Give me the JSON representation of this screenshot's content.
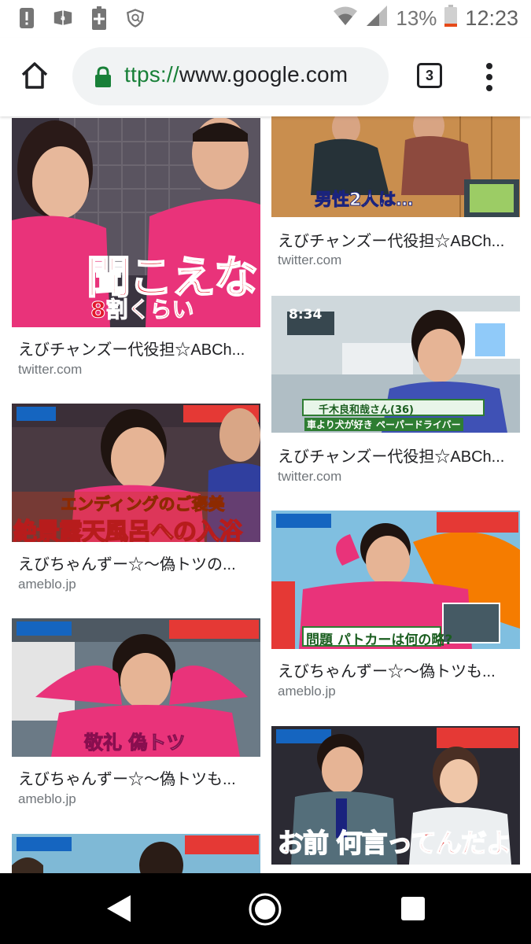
{
  "status_bar": {
    "battery_percent": "13%",
    "time": "12:23",
    "icons": [
      "alert-icon",
      "amazon-icon",
      "battery-saver-icon",
      "shield-icon",
      "wifi-icon",
      "signal-icon",
      "battery-icon"
    ]
  },
  "browser": {
    "url_scheme": "ttps://",
    "url_host": "www.google.com",
    "tab_count": "3",
    "icons": [
      "home-icon",
      "lock-icon",
      "tabs-icon",
      "overflow-menu-icon"
    ]
  },
  "results": {
    "left": [
      {
        "title": "えびチャンズー代役担☆ABCh...",
        "source": "twitter.com",
        "caption": "聞こえな",
        "caption2": "8割くらい"
      },
      {
        "title": "えびちゃんずー☆～偽トツの...",
        "source": "ameblo.jp",
        "caption": "絶景露天風呂への入浴",
        "caption2": "エンディングのご褒美"
      },
      {
        "title": "えびちゃんずー☆～偽トツも...",
        "source": "ameblo.jp",
        "caption": "敬礼 偽トツ",
        "caption2": ""
      },
      {
        "title": "",
        "source": "",
        "caption": "",
        "caption2": ""
      }
    ],
    "right": [
      {
        "title": "えびチャンズー代役担☆ABCh...",
        "source": "twitter.com",
        "caption": "男性2人は…",
        "caption2": ""
      },
      {
        "title": "えびチャンズー代役担☆ABCh...",
        "source": "twitter.com",
        "caption": "千木良和哉さん(36)",
        "caption2": "車より犬が好き ペーパードライバー",
        "clock": "8:34"
      },
      {
        "title": "えびちゃんずー☆～偽トツも...",
        "source": "ameblo.jp",
        "caption": "問題 パトカーは何の略?",
        "caption2": ""
      },
      {
        "title": "",
        "source": "",
        "caption": "お前 何言ってんだよ",
        "caption2": ""
      }
    ]
  },
  "nav_bar": {
    "icons": [
      "back-icon",
      "home-circle-icon",
      "recents-icon"
    ]
  }
}
